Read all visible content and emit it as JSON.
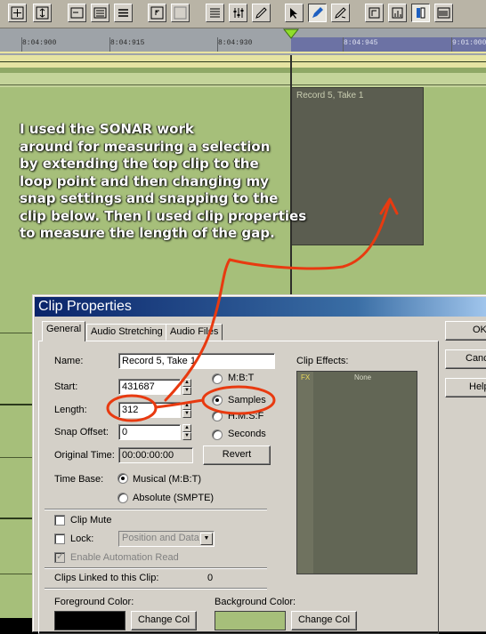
{
  "toolbar": {
    "buttons": [
      {
        "name": "fit-project-icon",
        "x": "⊞"
      },
      {
        "name": "fit-tracks-icon",
        "x": "⇳"
      },
      {
        "name": "track-view-icon",
        "x": "▭"
      },
      {
        "name": "staff-view-icon",
        "x": "☰"
      },
      {
        "name": "list-view-icon",
        "x": "≡"
      },
      {
        "name": "undo-view-icon",
        "x": "↶"
      },
      {
        "name": "redo-view-icon",
        "x": "↷"
      },
      {
        "name": "marker-list-icon",
        "x": "☷"
      },
      {
        "name": "mixer-icon",
        "x": "⚙"
      },
      {
        "name": "draw-tool-icon",
        "x": "✎"
      },
      {
        "name": "select-tool-icon",
        "x": "↖"
      },
      {
        "name": "edit-tool-icon",
        "x": "✐"
      },
      {
        "name": "erase-tool-icon",
        "x": "✂"
      },
      {
        "name": "snap-icon",
        "x": "⌐"
      },
      {
        "name": "grid-icon",
        "x": "▦"
      },
      {
        "name": "loop-icon",
        "x": "▮"
      },
      {
        "name": "meter-icon",
        "x": "▤"
      }
    ]
  },
  "ruler": {
    "ticks": [
      "8:04:900",
      "8:04:915",
      "8:04:930",
      "8:04:945",
      "9:01:000"
    ]
  },
  "track": {
    "clip_label": "Record 5, Take 1"
  },
  "annotation": {
    "lines": [
      "I used the SONAR work",
      "around for measuring a selection",
      "by extending the top clip to the",
      "loop point and then changing my",
      "snap settings and  snapping to the",
      "clip below. Then I used clip properties",
      "to measure the length of the gap."
    ]
  },
  "dialog": {
    "title": "Clip Properties",
    "tabs": [
      "General",
      "Audio Stretching",
      "Audio Files"
    ],
    "name_label": "Name:",
    "name_value": "Record 5, Take 1",
    "start_label": "Start:",
    "start_value": "431687",
    "length_label": "Length:",
    "length_value": "312",
    "snap_offset_label": "Snap Offset:",
    "snap_offset_value": "0",
    "original_time_label": "Original Time:",
    "original_time_value": "00:00:00:00",
    "format_options": [
      "M:B:T",
      "Samples",
      "H:M:S:F",
      "Seconds"
    ],
    "format_selected": "Samples",
    "revert_label": "Revert",
    "time_base_label": "Time Base:",
    "time_base_options": [
      "Musical (M:B:T)",
      "Absolute (SMPTE)"
    ],
    "time_base_selected": "Musical (M:B:T)",
    "clip_mute_label": "Clip Mute",
    "lock_label": "Lock:",
    "lock_value": "Position and Data",
    "enable_automation_label": "Enable Automation Read",
    "clips_linked_label": "Clips Linked to this Clip:",
    "clips_linked_value": "0",
    "clip_effects_label": "Clip Effects:",
    "fx_label": "FX",
    "fx_value": "None",
    "foreground_color_label": "Foreground Color:",
    "background_color_label": "Background Color:",
    "change_color_label": "Change Col",
    "ok_label": "OK",
    "cancel_label": "Cancel",
    "help_label": "Help"
  },
  "colors": {
    "track_bg": "#a6bf7a",
    "clip_bg": "#5b5d50",
    "annotation_arrow": "#e83a10",
    "title_bar": "#0a246a",
    "loop_region": "#6c72a4"
  }
}
